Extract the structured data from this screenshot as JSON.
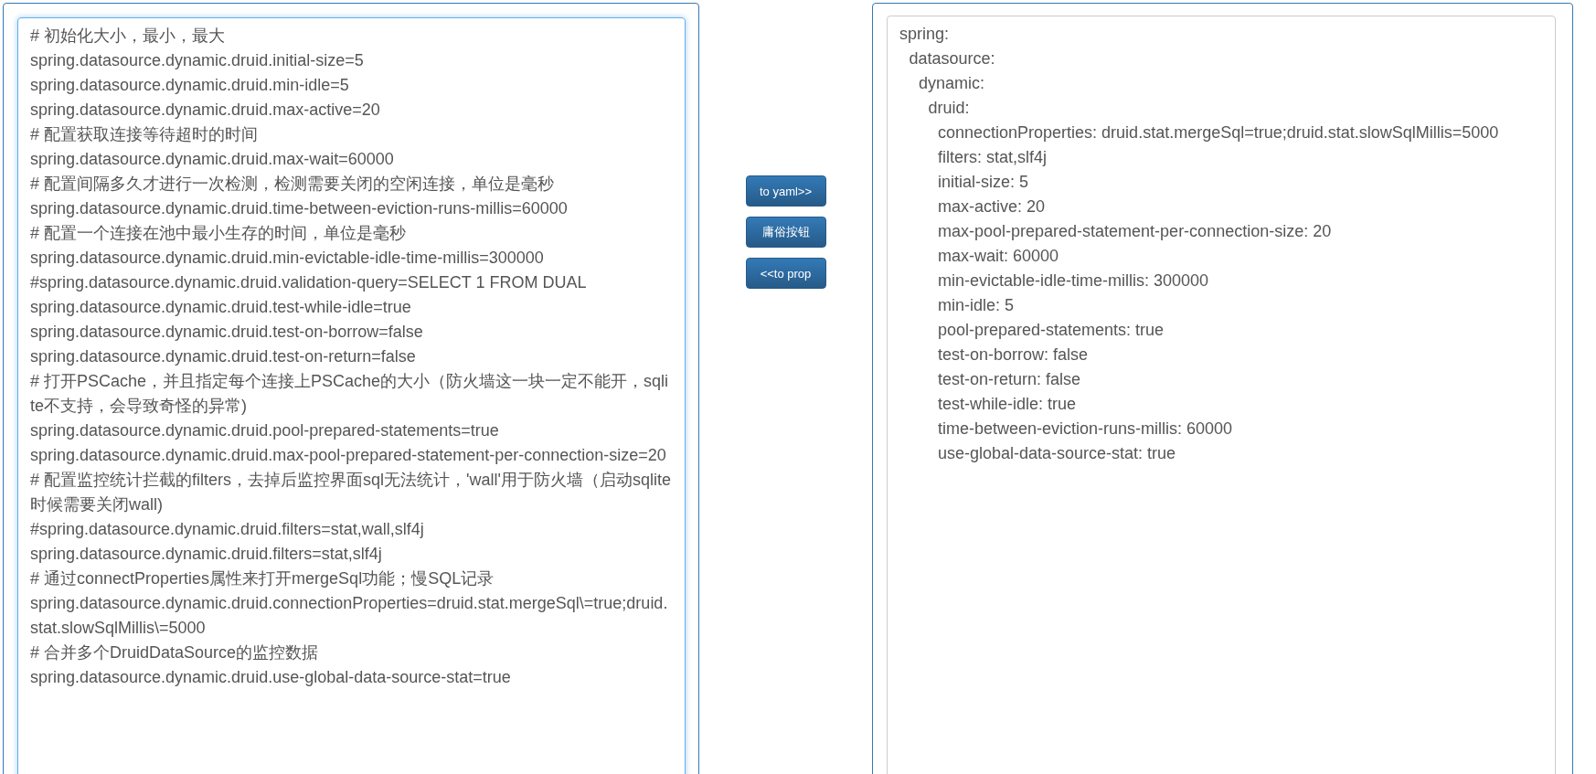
{
  "properties_editor": {
    "lines": [
      "# 初始化大小，最小，最大",
      "spring.datasource.dynamic.druid.initial-size=5",
      "spring.datasource.dynamic.druid.min-idle=5",
      "spring.datasource.dynamic.druid.max-active=20",
      "# 配置获取连接等待超时的时间",
      "spring.datasource.dynamic.druid.max-wait=60000",
      "# 配置间隔多久才进行一次检测，检测需要关闭的空闲连接，单位是毫秒",
      "spring.datasource.dynamic.druid.time-between-eviction-runs-millis=60000",
      "# 配置一个连接在池中最小生存的时间，单位是毫秒",
      "spring.datasource.dynamic.druid.min-evictable-idle-time-millis=300000",
      "#spring.datasource.dynamic.druid.validation-query=SELECT 1 FROM DUAL",
      "spring.datasource.dynamic.druid.test-while-idle=true",
      "spring.datasource.dynamic.druid.test-on-borrow=false",
      "spring.datasource.dynamic.druid.test-on-return=false",
      "# 打开PSCache，并且指定每个连接上PSCache的大小（防火墙这一块一定不能开，sqlite不支持，会导致奇怪的异常)",
      "spring.datasource.dynamic.druid.pool-prepared-statements=true",
      "spring.datasource.dynamic.druid.max-pool-prepared-statement-per-connection-size=20",
      "# 配置监控统计拦截的filters，去掉后监控界面sql无法统计，'wall'用于防火墙（启动sqlite时候需要关闭wall)",
      "#spring.datasource.dynamic.druid.filters=stat,wall,slf4j",
      "spring.datasource.dynamic.druid.filters=stat,slf4j",
      "# 通过connectProperties属性来打开mergeSql功能；慢SQL记录",
      "spring.datasource.dynamic.druid.connectionProperties=druid.stat.mergeSql\\=true;druid.stat.slowSqlMillis\\=5000",
      "# 合并多个DruidDataSource的监控数据",
      "spring.datasource.dynamic.druid.use-global-data-source-stat=true"
    ]
  },
  "buttons": [
    "to yaml>>",
    "庸俗按钮",
    "<<to prop"
  ],
  "yaml_output": {
    "tree": [
      {
        "text": "spring:",
        "children": [
          {
            "text": "datasource:",
            "children": [
              {
                "text": "dynamic:",
                "children": [
                  {
                    "text": "druid:",
                    "children": [
                      {
                        "text": "connectionProperties: druid.stat.mergeSql=true;druid.stat.slowSqlMillis=5000"
                      },
                      {
                        "text": "filters: stat,slf4j"
                      },
                      {
                        "text": "initial-size: 5"
                      },
                      {
                        "text": "max-active: 20"
                      },
                      {
                        "text": "max-pool-prepared-statement-per-connection-size: 20"
                      },
                      {
                        "text": "max-wait: 60000"
                      },
                      {
                        "text": "min-evictable-idle-time-millis: 300000"
                      },
                      {
                        "text": "min-idle: 5"
                      },
                      {
                        "text": "pool-prepared-statements: true"
                      },
                      {
                        "text": "test-on-borrow: false"
                      },
                      {
                        "text": "test-on-return: false"
                      },
                      {
                        "text": "test-while-idle: true"
                      },
                      {
                        "text": "time-between-eviction-runs-millis: 60000"
                      },
                      {
                        "text": "use-global-data-source-stat: true"
                      }
                    ]
                  }
                ]
              }
            ]
          }
        ]
      }
    ]
  }
}
